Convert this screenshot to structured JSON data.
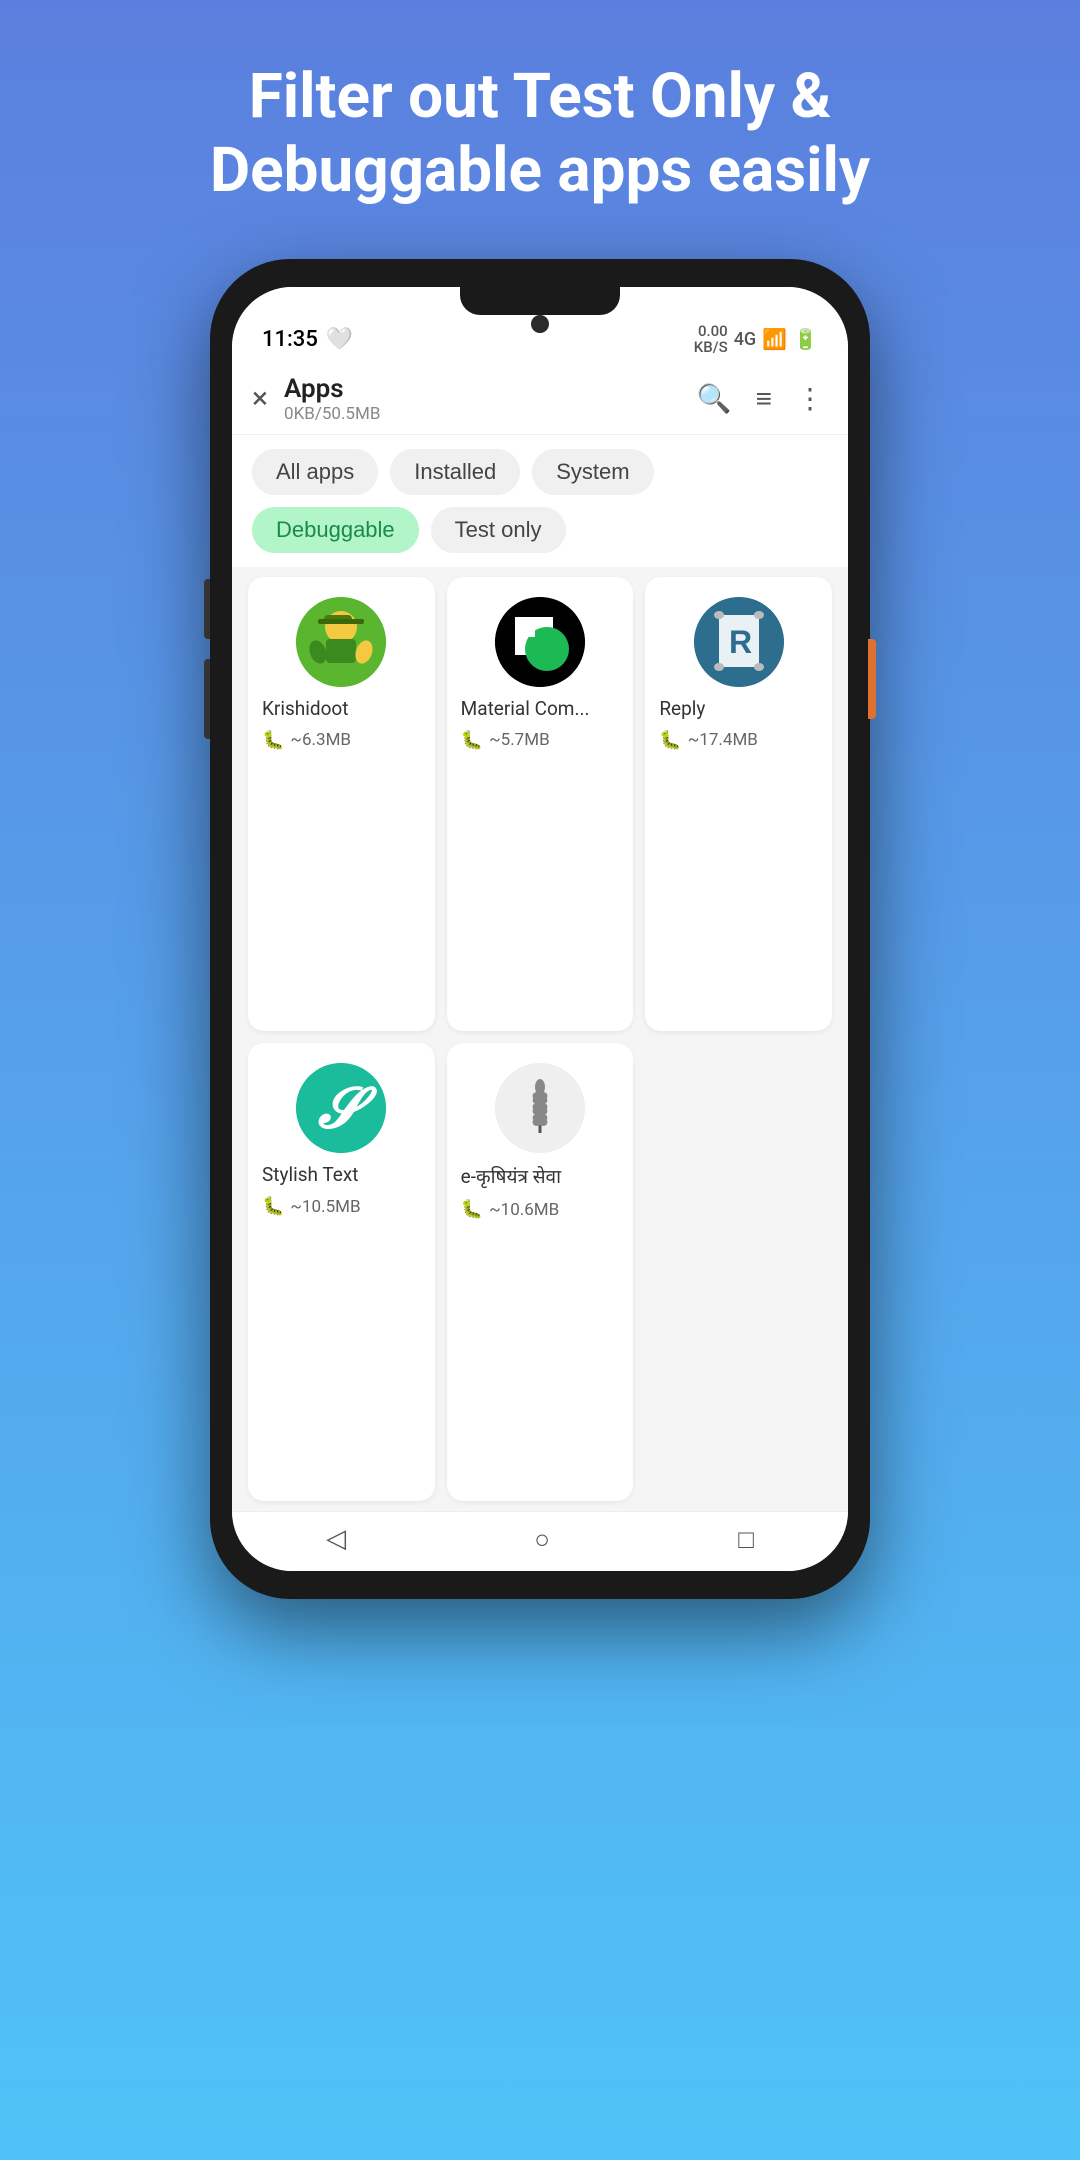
{
  "hero": {
    "line1": "Filter out Test Only &",
    "line2": "Debuggable apps easily"
  },
  "status_bar": {
    "time": "11:35",
    "network": "0.00\nKB/S",
    "signal": "4G"
  },
  "toolbar": {
    "title": "Apps",
    "subtitle": "0KB/50.5MB",
    "close_label": "×",
    "search_label": "search",
    "filter_label": "filter",
    "more_label": "more"
  },
  "filter_tabs": [
    {
      "id": "all",
      "label": "All apps",
      "active": false
    },
    {
      "id": "installed",
      "label": "Installed",
      "active": false
    },
    {
      "id": "system",
      "label": "System",
      "active": false
    },
    {
      "id": "debuggable",
      "label": "Debuggable",
      "active": true
    },
    {
      "id": "testonly",
      "label": "Test only",
      "active": false
    }
  ],
  "apps": [
    {
      "name": "Krishidoot",
      "size": "~6.3MB",
      "icon_type": "krishidoot"
    },
    {
      "name": "Material Com...",
      "size": "~5.7MB",
      "icon_type": "material"
    },
    {
      "name": "Reply",
      "size": "~17.4MB",
      "icon_type": "reply"
    },
    {
      "name": "Stylish Text",
      "size": "~10.5MB",
      "icon_type": "stylish"
    },
    {
      "name": "e-कृषियंत्र सेवा",
      "size": "~10.6MB",
      "icon_type": "ekrishi"
    }
  ],
  "nav": {
    "back": "◁",
    "home": "○",
    "recent": "□"
  }
}
